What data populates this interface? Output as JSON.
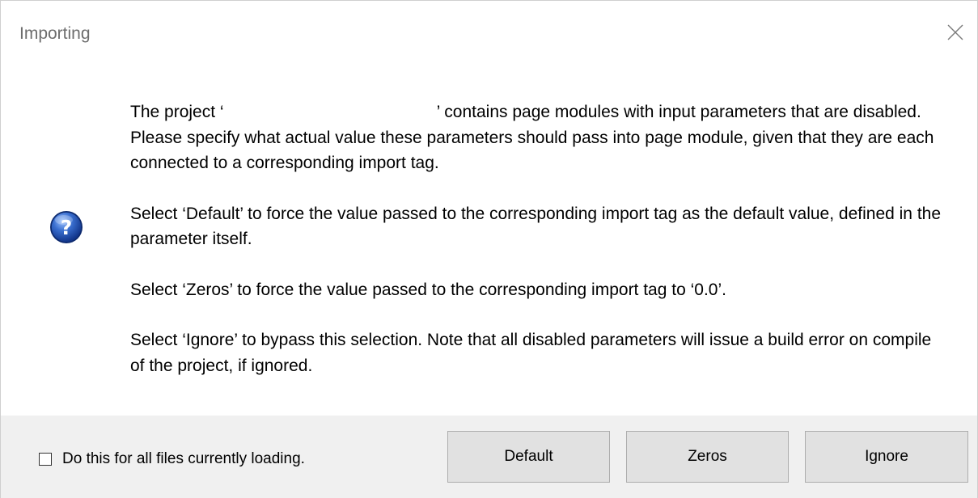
{
  "window": {
    "title": "Importing"
  },
  "message": {
    "p1_before": "The project ‘",
    "p1_after": "’ contains page modules with input parameters that are disabled. Please specify what actual value these parameters should pass into page module, given that they are each connected to a corresponding import tag.",
    "p2": "Select ‘Default’ to force the value passed to the corresponding import tag as the default value, defined in the parameter itself.",
    "p3": "Select ‘Zeros’ to force the value passed to the corresponding import tag to ‘0.0’.",
    "p4": "Select ‘Ignore’ to bypass this selection. Note that all disabled parameters will issue a build error on compile of the project, if ignored."
  },
  "footer": {
    "checkbox_label": "Do this for all files currently loading.",
    "checkbox_checked": false,
    "buttons": {
      "default": "Default",
      "zeros": "Zeros",
      "ignore": "Ignore"
    }
  },
  "icons": {
    "close": "close-icon",
    "question": "question-icon"
  },
  "colors": {
    "footer_bg": "#f0f0f0",
    "button_bg": "#e1e1e1",
    "button_border": "#adadad",
    "icon_blue": "#1f4fa8"
  }
}
